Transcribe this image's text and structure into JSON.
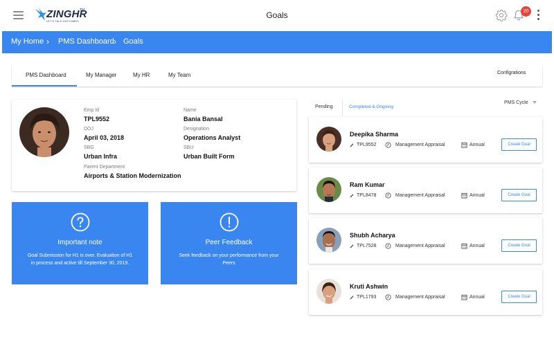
{
  "header": {
    "title": "Goals",
    "logo_word": "ZINGHR",
    "logo_tm": "TM",
    "logo_tagline": "LET'S TALK OUTCOMES",
    "notification_count": "20"
  },
  "breadcrumb": {
    "items": [
      "My Home",
      "PMS Dashboard",
      "Goals"
    ]
  },
  "tabs": {
    "items": [
      "PMS Dashboard",
      "My Manager",
      "My HR",
      "My Team"
    ],
    "active": "PMS Dashboard",
    "configurations": "Configrations"
  },
  "profile": {
    "emp_id_label": "Emp Id",
    "emp_id": "TPL9552",
    "name_label": "Name",
    "name": "Bania Bansal",
    "doj_label": "DOJ",
    "doj": "April 03, 2018",
    "designation_label": "Designation",
    "designation": "Operations Analyst",
    "sbg_label": "SBG",
    "sbg": "Urban Infra",
    "sbu_label": "SBU",
    "sbu": "Urban Built Form",
    "parent_department_label": "Parent Department",
    "parent_department": "Airports & Station Modernization"
  },
  "cards": {
    "important": {
      "title": "Important note",
      "description": "Goal Submission for H1 is over. Evaluation of H1 in process and active till September 30, 2019."
    },
    "peer": {
      "title": "Peer Feedback",
      "description": "Seek feedback on your performance from your Peers"
    }
  },
  "right_panel": {
    "tab_pending": "Pending",
    "tab_completed": "Completed & Ongoing",
    "pms_cycle": "PMS Cycle",
    "employees": [
      {
        "name": "Deepika Sharma",
        "id": "TPL9552",
        "type": "Management Appraisal",
        "frequency": "Annual",
        "button": "Create Goal"
      },
      {
        "name": "Ram Kumar",
        "id": "TPL8478",
        "type": "Management Appraisal",
        "frequency": "Annual",
        "button": "Create Goal"
      },
      {
        "name": "Shubh Acharya",
        "id": "TPL7528",
        "type": "Management Appraisal",
        "frequency": "Annual",
        "button": "Create Goal"
      },
      {
        "name": "Kruti Ashwin",
        "id": "TPL1793",
        "type": "Management Appraisal",
        "frequency": "Annual",
        "button": "Create Goal"
      }
    ]
  },
  "colors": {
    "accent": "#3a86f0",
    "badge": "#e8433a"
  },
  "icons": [
    "menu-icon",
    "gear-icon",
    "bell-icon",
    "more-vert-icon",
    "question-circle-icon",
    "exclamation-circle-icon",
    "pin-icon",
    "clock-icon",
    "calendar-icon",
    "chevron-right-icon"
  ]
}
